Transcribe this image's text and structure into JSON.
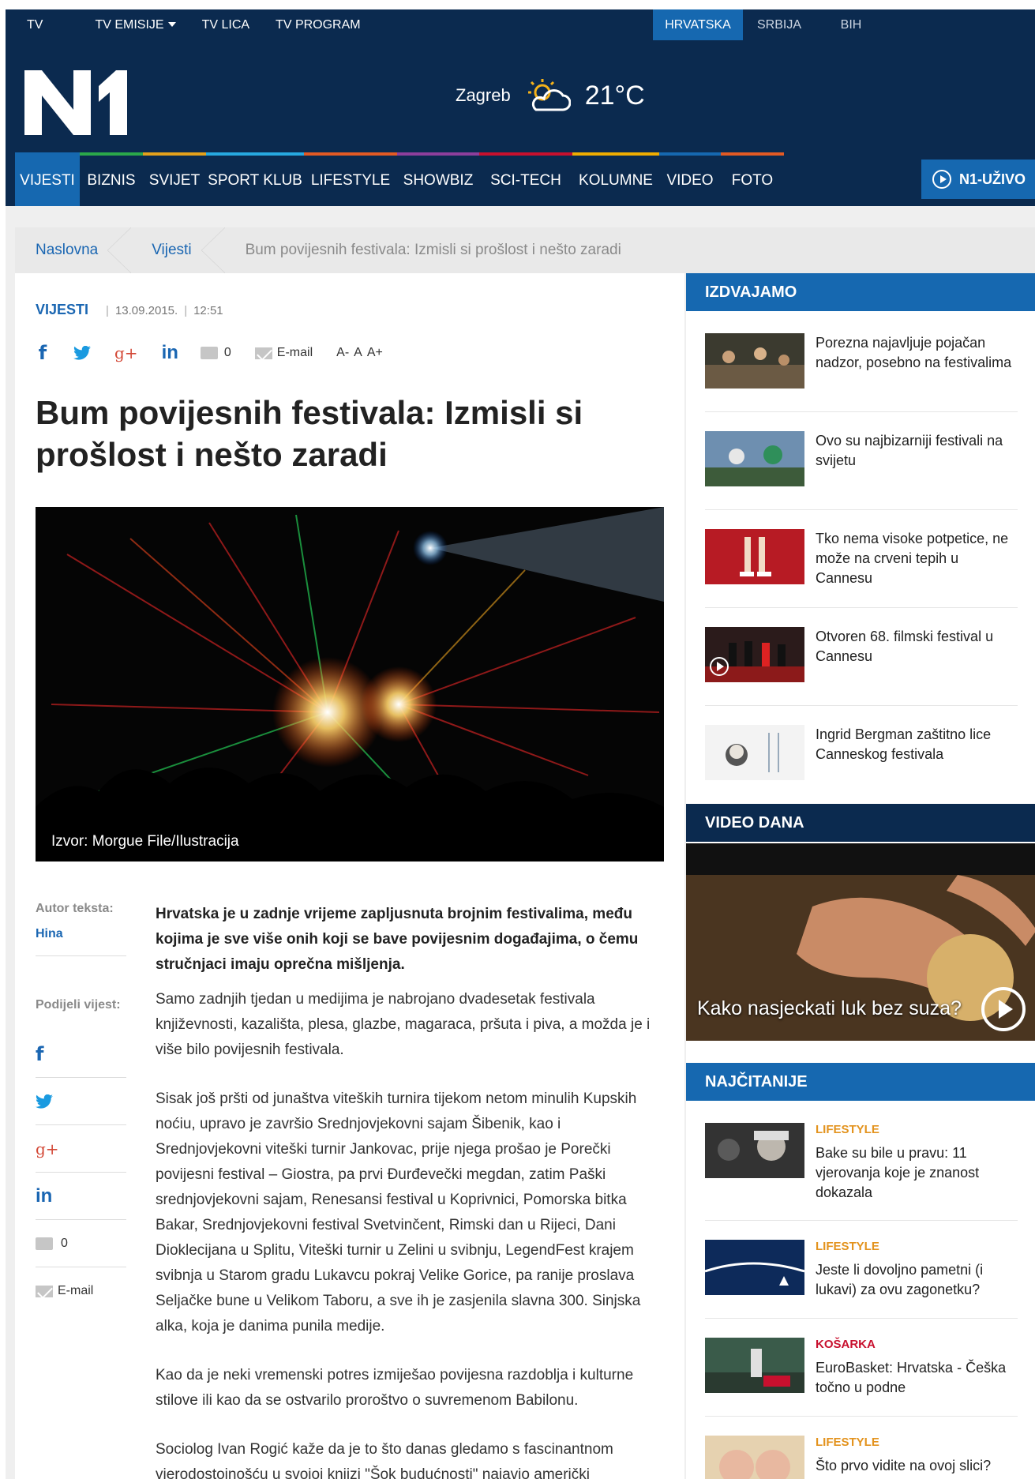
{
  "topbar": {
    "links": [
      "TV",
      "TV EMISIJE",
      "TV LICA",
      "TV PROGRAM"
    ],
    "regions": [
      "HRVATSKA",
      "SRBIJA",
      "BIH"
    ],
    "active_region": "HRVATSKA"
  },
  "header": {
    "logo_text": "N1",
    "weather": {
      "city": "Zagreb",
      "temp": "21°C",
      "icon": "partly-cloudy-icon"
    }
  },
  "nav": {
    "items": [
      "VIJESTI",
      "BIZNIS",
      "SVIJET",
      "SPORT KLUB",
      "LIFESTYLE",
      "SHOWBIZ",
      "SCI-TECH",
      "KOLUMNE",
      "VIDEO",
      "FOTO"
    ],
    "active": "VIJESTI",
    "accent_colors": [
      "#1668b0",
      "#2ba84a",
      "#e4a11b",
      "#27a9e0",
      "#e35a24",
      "#8e3e9c",
      "#c8102e",
      "#f0ad00",
      "#1668b0",
      "#e35a24"
    ],
    "live_label": "N1-UŽIVO"
  },
  "breadcrumb": [
    "Naslovna",
    "Vijesti",
    "Bum povijesnih festivala: Izmisli si prošlost i nešto zaradi"
  ],
  "article": {
    "category": "VIJESTI",
    "date": "13.09.2015.",
    "time": "12:51",
    "comments": "0",
    "email_label": "E-mail",
    "font_sizes": [
      "A-",
      "A",
      "A+"
    ],
    "title": "Bum povijesnih festivala: Izmisli si prošlost i nešto zaradi",
    "image_caption": "Izvor: Morgue File/Ilustracija",
    "author_label": "Autor teksta:",
    "author": "Hina",
    "share_label": "Podijeli vijest:",
    "lead": "Hrvatska je u zadnje vrijeme zapljusnuta brojnim festivalima, među kojima je sve više onih koji se bave povijesnim događajima, o čemu stručnjaci imaju oprečna mišljenja.",
    "p1": "Samo zadnjih tjedan u medijima je nabrojano dvadesetak festivala književnosti, kazališta, plesa, glazbe, magaraca, pršuta i piva, a možda je i više bilo povijesnih festivala.",
    "p2": "Sisak još pršti od junaštva viteških turnira tijekom netom minulih Kupskih noćiu, upravo je završio Srednjovjekovni sajam Šibenik, kao i Srednjovjekovni viteški turnir Jankovac, prije njega prošao je Porečki povijesni festival – Giostra, pa prvi Đurđevečki megdan, zatim Paški srednjovjekovni sajam, Renesansi festival u Koprivnici, Pomorska bitka Bakar, Srednjovjekovni festival Svetvinčent, Rimski dan u Rijeci, Dani Dioklecijana u Splitu, Viteški turnir u Zelini u svibnju, LegendFest krajem svibnja u Starom gradu Lukavcu pokraj Velike Gorice, pa ranije proslava Seljačke bune u Velikom Taboru, a sve ih je zasjenila slavna 300. Sinjska alka, koja je danima punila medije.",
    "p3": "Kao da je neki vremenski potres izmiješao povijesna razdoblja i kulturne stilove ili kao da se ostvarilo proroštvo o suvremenom Babilonu.",
    "p4": "Sociolog Ivan Rogić kaže da je to što danas gledamo s fascinantnom vjerodostojnošću u svojoj knjizi \"Šok budućnosti\" najavio američki"
  },
  "sidebar": {
    "izdvajamo_title": "IZDVAJAMO",
    "izdvajamo": [
      "Porezna najavljuje pojačan nadzor, posebno na festivalima",
      "Ovo su najbizarniji festivali na svijetu",
      "Tko nema visoke potpetice, ne može na crveni tepih u Cannesu",
      "Otvoren 68. filmski festival u Cannesu",
      "Ingrid Bergman zaštitno lice Canneskog festivala"
    ],
    "video_title": "VIDEO DANA",
    "video_caption": "Kako nasjeckati luk bez suza?",
    "najcitanije_title": "NAJČITANIJE",
    "najcitanije": [
      {
        "category": "LIFESTYLE",
        "title": "Bake su bile u pravu: 11 vjerovanja koje je znanost dokazala"
      },
      {
        "category": "LIFESTYLE",
        "title": "Jeste li dovoljno pametni (i lukavi) za ovu zagonetku?"
      },
      {
        "category": "KOŠARKA",
        "title": "EuroBasket: Hrvatska - Češka točno u podne"
      },
      {
        "category": "LIFESTYLE",
        "title": "Što prvo vidite na ovoj slici?"
      }
    ]
  }
}
